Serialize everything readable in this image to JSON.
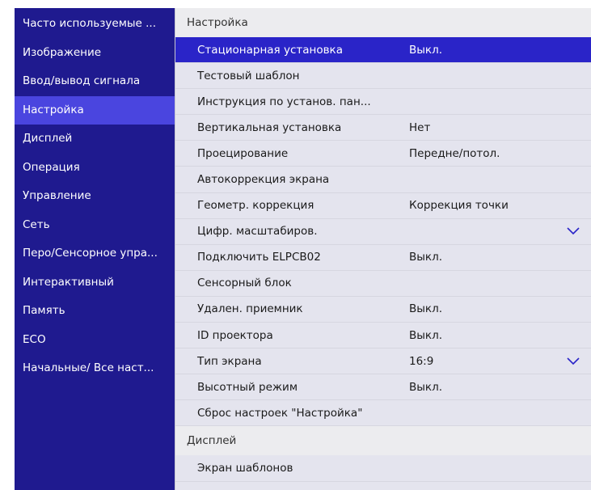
{
  "sidebar": {
    "items": [
      {
        "label": "Часто используемые ..."
      },
      {
        "label": "Изображение"
      },
      {
        "label": "Ввод/вывод сигнала"
      },
      {
        "label": "Настройка",
        "selected": true
      },
      {
        "label": "Дисплей"
      },
      {
        "label": "Операция"
      },
      {
        "label": "Управление"
      },
      {
        "label": "Сеть"
      },
      {
        "label": "Перо/Сенсорное упра..."
      },
      {
        "label": "Интерактивный"
      },
      {
        "label": "Память"
      },
      {
        "label": "ECO"
      },
      {
        "label": "Начальные/ Все наст..."
      }
    ]
  },
  "main": {
    "section_title": "Настройка",
    "rows": [
      {
        "label": "Стационарная установка",
        "value": "Выкл."
      },
      {
        "label": "Тестовый шаблон",
        "value": ""
      },
      {
        "label": "Инструкция по установ. пан...",
        "value": ""
      },
      {
        "label": "Вертикальная установка",
        "value": "Нет"
      },
      {
        "label": "Проецирование",
        "value": "Передне/потол."
      },
      {
        "label": "Автокоррекция экрана",
        "value": ""
      },
      {
        "label": "Геометр. коррекция",
        "value": "Коррекция точки"
      },
      {
        "label": "Цифр. масштабиров.",
        "value": ""
      },
      {
        "label": "Подключить ELPCB02",
        "value": "Выкл."
      },
      {
        "label": "Сенсорный блок",
        "value": ""
      },
      {
        "label": "Удален. приемник",
        "value": "Выкл."
      },
      {
        "label": "ID проектора",
        "value": "Выкл."
      },
      {
        "label": "Тип экрана",
        "value": "16:9"
      },
      {
        "label": "Высотный режим",
        "value": "Выкл."
      },
      {
        "label": "Сброс настроек \"Настройка\"",
        "value": ""
      }
    ],
    "next_section_title": "Дисплей",
    "next_rows": [
      {
        "label": "Экран шаблонов",
        "value": ""
      }
    ]
  },
  "icons": {
    "expand": "chevron-down-icon"
  },
  "colors": {
    "sidebar_bg": "#1f1a8f",
    "sidebar_selected": "#4a45df",
    "row_selected": "#2a24c8",
    "row_bg": "#e4e4ee"
  }
}
